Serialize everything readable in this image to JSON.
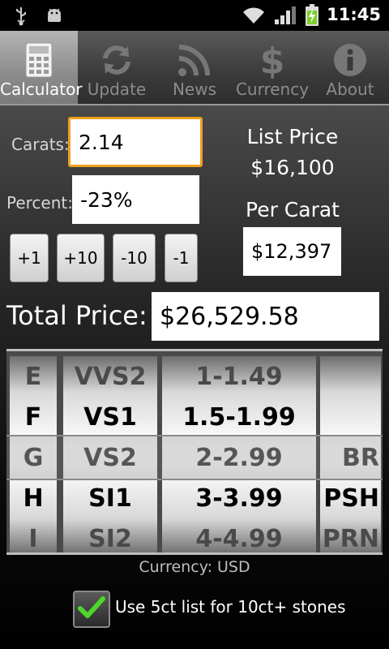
{
  "status_bar": {
    "time": "11:45"
  },
  "tabs": [
    {
      "label": "Calculator",
      "icon": "calculator-icon",
      "active": true
    },
    {
      "label": "Update",
      "icon": "refresh-icon",
      "active": false
    },
    {
      "label": "News",
      "icon": "rss-icon",
      "active": false
    },
    {
      "label": "Currency",
      "icon": "dollar-icon",
      "active": false
    },
    {
      "label": "About",
      "icon": "info-icon",
      "active": false
    }
  ],
  "calculator": {
    "carats_label": "Carats:",
    "carats_value": "2.14",
    "percent_label": "Percent:",
    "percent_value": "-23%",
    "steppers": [
      "+1",
      "+10",
      "-10",
      "-1"
    ],
    "list_price_label": "List Price",
    "list_price_value": "$16,100",
    "per_carat_label": "Per Carat",
    "per_carat_value": "$12,397",
    "total_price_label": "Total Price:",
    "total_price_value": "$26,529.58"
  },
  "picker": {
    "color": [
      "E",
      "F",
      "G",
      "H",
      "I"
    ],
    "clarity": [
      "VVS2",
      "VS1",
      "VS2",
      "SI1",
      "SI2"
    ],
    "size": [
      "1-1.49",
      "1.5-1.99",
      "2-2.99",
      "3-3.99",
      "4-4.99"
    ],
    "shape": [
      "",
      "",
      "BR",
      "PSH",
      "PRN"
    ],
    "selected_index": 2
  },
  "footer": {
    "currency_note": "Currency: USD",
    "checkbox_label": "Use 5ct list for 10ct+ stones",
    "checkbox_checked": true
  },
  "colors": {
    "focus_border": "#f0a020",
    "check_mark": "#4fd62a",
    "battery": "#7ad22a"
  }
}
